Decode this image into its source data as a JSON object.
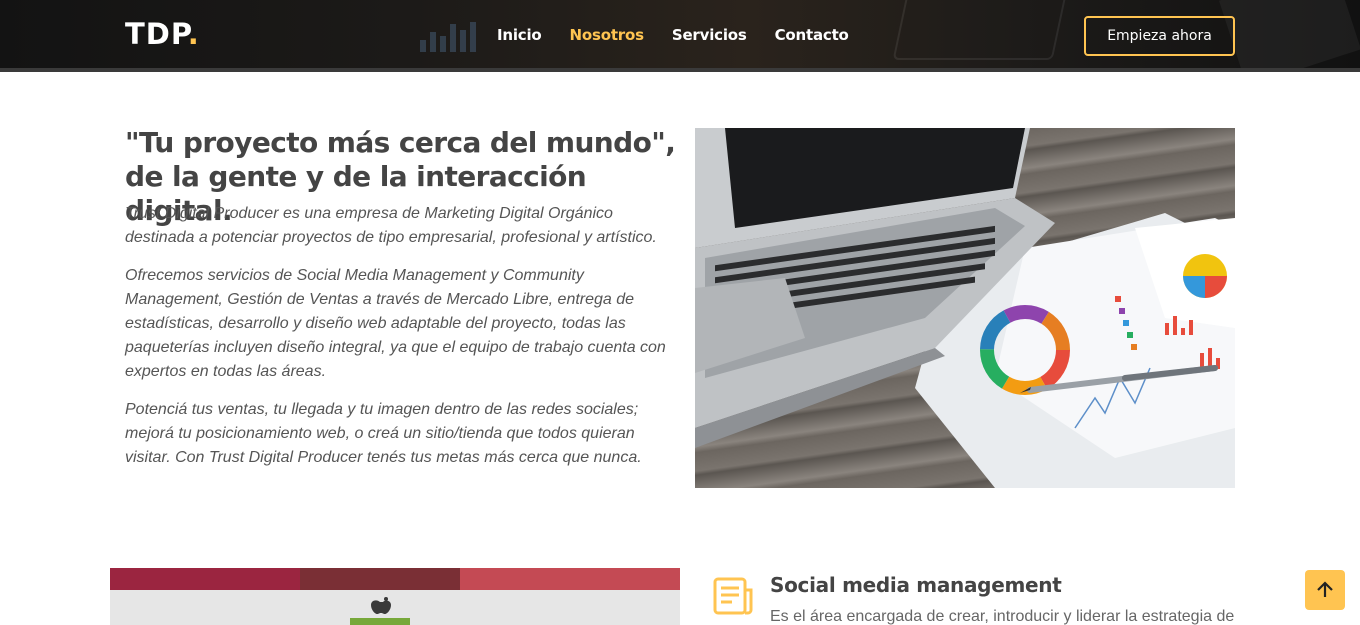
{
  "header": {
    "logo_text": "TDP",
    "logo_dot": ".",
    "nav": [
      {
        "label": "Inicio",
        "active": false
      },
      {
        "label": "Nosotros",
        "active": true
      },
      {
        "label": "Servicios",
        "active": false
      },
      {
        "label": "Contacto",
        "active": false
      }
    ],
    "cta_label": "Empieza ahora"
  },
  "about": {
    "title": "\"Tu proyecto más cerca del mundo\", de la gente y de la interacción digital.",
    "paragraphs": [
      "Trust Digital Producer es una empresa de Marketing Digital Orgánico destinada a potenciar proyectos de tipo empresarial, profesional y artístico.",
      "Ofrecemos servicios de Social Media Management y Community Management, Gestión de Ventas a través de Mercado Libre, entrega de estadísticas, desarrollo y diseño web adaptable del proyecto, todas las paqueterías incluyen diseño integral, ya que el equipo de trabajo cuenta con expertos en todas las áreas.",
      "Potenciá tus ventas, tu llegada y tu imagen dentro de las redes sociales; mejorá tu posicionamiento web, o creá un sitio/tienda que todos quieran visitar. Con Trust Digital Producer tenés tus metas más cerca que nunca."
    ],
    "image_icon": "laptop-with-charts-photo"
  },
  "services": {
    "first": {
      "icon": "document-icon",
      "title": "Social media management",
      "description": "Es el área encargada de crear, introducir y liderar la estrategia de"
    }
  },
  "back_to_top_icon": "arrow-up-icon",
  "colors": {
    "accent": "#ffc451",
    "header_bg": "#151515",
    "text_dark": "#444444",
    "text_body": "#555555"
  }
}
